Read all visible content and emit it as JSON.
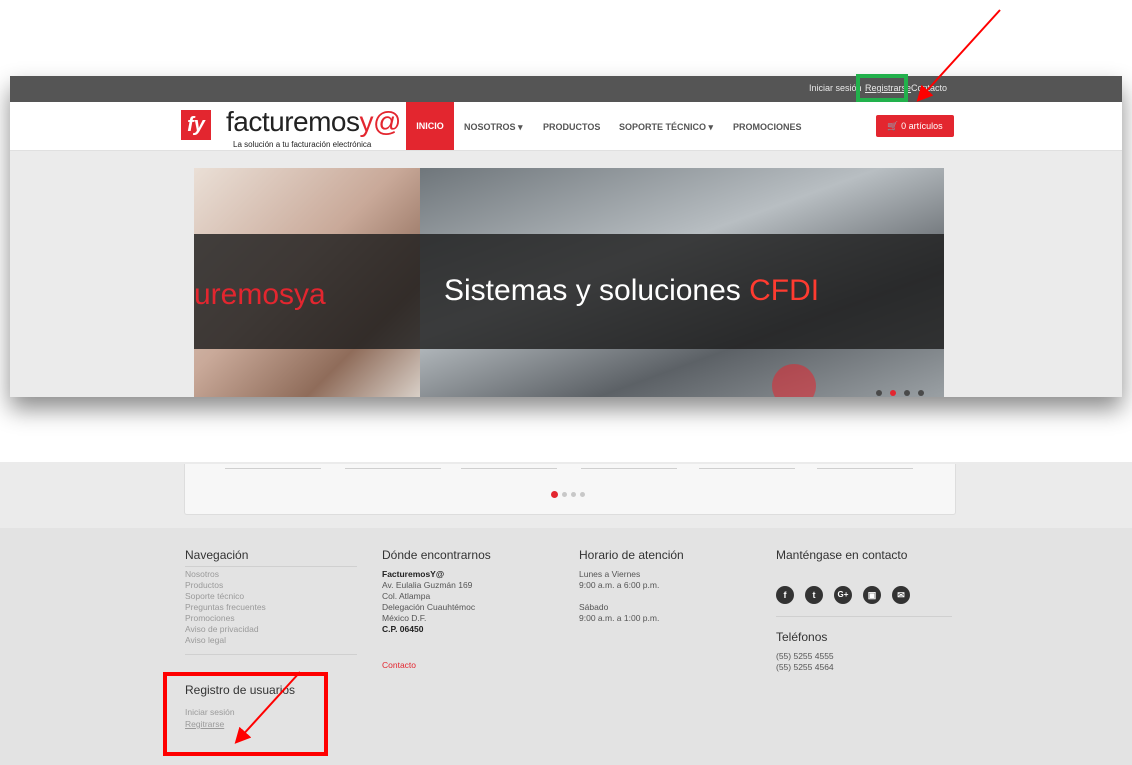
{
  "topbar": {
    "login": "Iniciar sesión",
    "register": "Registrarse",
    "contact": "Contacto"
  },
  "nav": {
    "logo_mark": "fy",
    "logo_name_a": "facturemos",
    "logo_name_b": "y@",
    "tagline": "La solución a tu facturación electrónica",
    "items": [
      "INICIO",
      "NOSOTROS ▾",
      "PRODUCTOS",
      "SOPORTE TÉCNICO ▾",
      "PROMOCIONES"
    ],
    "cart": "0 artículos"
  },
  "slider": {
    "brand": "uremosya",
    "title_a": "Sistemas y soluciones ",
    "title_b": "CFDI"
  },
  "footer": {
    "nav_heading": "Navegación",
    "nav_links": [
      "Nosotros",
      "Productos",
      "Soporte técnico",
      "Preguntas frecuentes",
      "Promociones",
      "Aviso de privacidad",
      "Aviso legal"
    ],
    "where_heading": "Dónde encontrarnos",
    "where_company": "FacturemosY@",
    "where_lines": [
      "Av. Eulalia Guzmán 169",
      "Col. Atlampa",
      "Delegación Cuauhtémoc",
      "México D.F."
    ],
    "where_cp": "C.P. 06450",
    "where_contact": "Contacto",
    "hours_heading": "Horario de atención",
    "hours_weekday_label": "Lunes a Viernes",
    "hours_weekday": "9:00 a.m. a 6:00 p.m.",
    "hours_sat_label": "Sábado",
    "hours_sat": "9:00 a.m. a 1:00 p.m.",
    "contact_heading": "Manténgase en contacto",
    "social_glyphs": [
      "f",
      "t",
      "G+",
      "▣",
      "✉"
    ],
    "phones_heading": "Teléfonos",
    "phones": [
      "(55) 5255 4555",
      "(55) 5255 4564"
    ],
    "reg_heading": "Registro de usuarios",
    "reg_login": "Iniciar sesión",
    "reg_register": "Regitrarse"
  },
  "colors": {
    "brand_red": "#e3262f",
    "highlight_green": "#22b14c",
    "annotation_red": "#ff0000"
  }
}
